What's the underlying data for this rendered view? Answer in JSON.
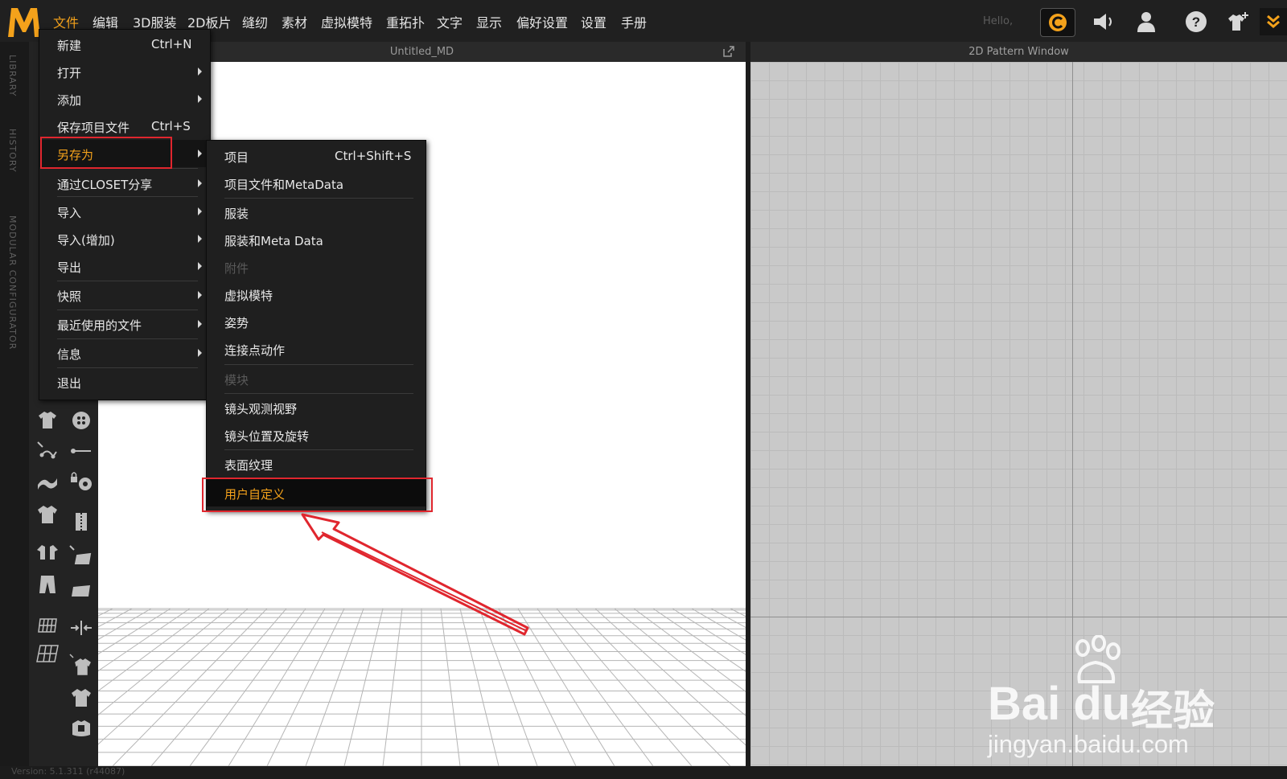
{
  "app": {
    "logo": "MD",
    "hello": "Hello,"
  },
  "menubar": {
    "items": [
      "文件",
      "编辑",
      "3D服装",
      "2D板片",
      "缝纫",
      "素材",
      "虚拟模特",
      "重拓扑",
      "文字",
      "显示",
      "偏好设置",
      "设置",
      "手册"
    ]
  },
  "toolbar_icons": [
    "closet-logo-icon",
    "speaker-icon",
    "user-icon",
    "help-icon",
    "shirt-add-icon",
    "expand-chevron-icon"
  ],
  "side_tabs": [
    "LIBRARY",
    "HISTORY",
    "MODULAR CONFIGURATOR"
  ],
  "windows": {
    "win3d_title": "Untitled_MD",
    "win2d_title": "2D Pattern Window"
  },
  "file_menu": {
    "items": [
      {
        "label": "新建",
        "shortcut": "Ctrl+N"
      },
      {
        "label": "打开",
        "submenu": true
      },
      {
        "label": "添加",
        "submenu": true
      },
      {
        "label": "保存项目文件",
        "shortcut": "Ctrl+S"
      },
      {
        "label": "另存为",
        "submenu": true,
        "active": true
      },
      {
        "label": "通过CLOSET分享",
        "submenu": true
      },
      {
        "label": "导入",
        "submenu": true
      },
      {
        "label": "导入(增加)",
        "submenu": true
      },
      {
        "label": "导出",
        "submenu": true
      },
      {
        "label": "快照",
        "submenu": true
      },
      {
        "label": "最近使用的文件",
        "submenu": true
      },
      {
        "label": "信息",
        "submenu": true
      },
      {
        "label": "退出"
      }
    ]
  },
  "saveas_menu": {
    "items": [
      {
        "label": "项目",
        "shortcut": "Ctrl+Shift+S"
      },
      {
        "label": "项目文件和MetaData"
      },
      {
        "label": "服装"
      },
      {
        "label": "服装和Meta Data"
      },
      {
        "label": "附件",
        "disabled": true
      },
      {
        "label": "虚拟模特"
      },
      {
        "label": "姿势"
      },
      {
        "label": "连接点动作"
      },
      {
        "label": "模块",
        "disabled": true
      },
      {
        "label": "镜头观测视野"
      },
      {
        "label": "镜头位置及旋转"
      },
      {
        "label": "表面纹理"
      },
      {
        "label": "用户自定义",
        "highlighted": true
      }
    ]
  },
  "status": {
    "version": "Version: 5.1.311 (r44087)"
  },
  "watermark": {
    "brand": "Bai du",
    "brand_cn": "经验",
    "url": "jingyan.baidu.com"
  },
  "colors": {
    "accent": "#f4a21b",
    "annotation_red": "#e0262e"
  }
}
